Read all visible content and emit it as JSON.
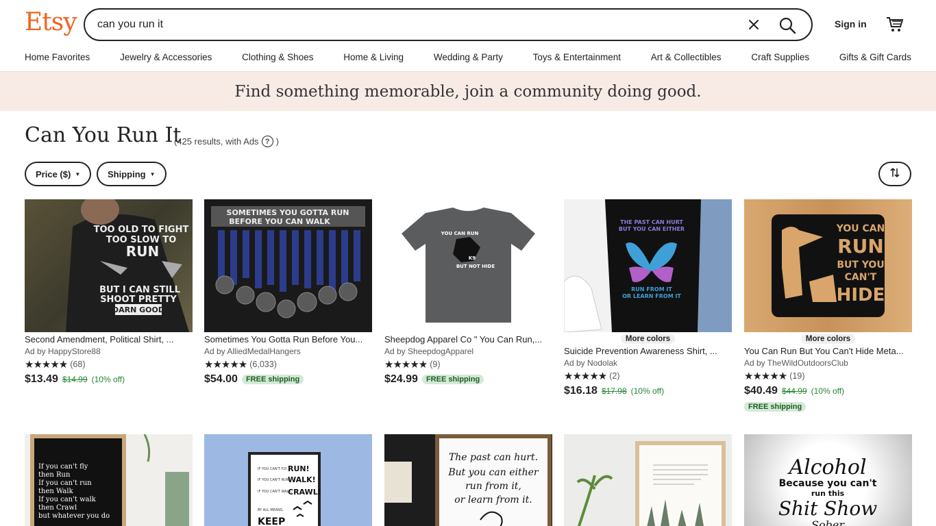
{
  "header": {
    "logo": "Etsy",
    "search_value": "can you run it",
    "sign_in": "Sign in"
  },
  "nav": [
    "Home Favorites",
    "Jewelry & Accessories",
    "Clothing & Shoes",
    "Home & Living",
    "Wedding & Party",
    "Toys & Entertainment",
    "Art & Collectibles",
    "Craft Supplies",
    "Gifts & Gift Cards"
  ],
  "banner": "Find something memorable, join a community doing good.",
  "results": {
    "title": "Can You Run It",
    "meta": "(425 results, with Ads",
    "meta_close": ")"
  },
  "filters": {
    "price": "Price ($)",
    "shipping": "Shipping"
  },
  "listings": [
    {
      "title": "Second Amendment, Political Shirt, ...",
      "shop": "Ad by HappyStore88",
      "stars": "★★★★★",
      "count": "(68)",
      "price": "$13.49",
      "orig": "$14.99",
      "off": "(10% off)",
      "img_text": [
        "TOO OLD TO FIGHT",
        "TOO SLOW TO",
        "RUN",
        "BUT I CAN STILL",
        "SHOOT PRETTY",
        "DARN GOOD"
      ]
    },
    {
      "title": "Sometimes You Gotta Run Before You...",
      "shop": "Ad by AlliedMedalHangers",
      "stars": "★★★★★",
      "count": "(6,033)",
      "price": "$54.00",
      "ship": "FREE shipping",
      "img_text": [
        "SOMETIMES YOU GOTTA RUN",
        "BEFORE YOU CAN WALK"
      ]
    },
    {
      "title": "Sheepdog Apparel Co \" You Can Run,...",
      "shop": "Ad by SheepdogApparel",
      "stars": "★★★★★",
      "count": "(9)",
      "price": "$24.99",
      "ship": "FREE shipping",
      "img_text": [
        "YOU CAN RUN",
        "K9",
        "BUT NOT HIDE"
      ]
    },
    {
      "more": "More colors",
      "title": "Suicide Prevention Awareness Shirt, ...",
      "shop": "Ad by Nodolak",
      "stars": "★★★★★",
      "count": "(2)",
      "price": "$16.18",
      "orig": "$17.98",
      "off": "(10% off)",
      "img_text": [
        "THE PAST CAN HURT",
        "BUT YOU CAN EITHER",
        "RUN FROM IT",
        "OR LEARN FROM IT"
      ]
    },
    {
      "more": "More colors",
      "title": "You Can Run But You Can't Hide Meta...",
      "shop": "Ad by TheWildOutdoorsClub",
      "stars": "★★★★★",
      "count": "(19)",
      "price": "$40.49",
      "orig": "$44.99",
      "off": "(10% off)",
      "ship": "FREE shipping",
      "img_text": [
        "YOU CAN",
        "RUN",
        "BUT YOU",
        "CAN'T",
        "HIDE"
      ]
    }
  ],
  "row2": [
    {
      "img_text": [
        "If you can't fly",
        "then Run",
        "If you can't run",
        "then Walk",
        "If you can't walk",
        "then Crawl",
        "but whatever you do"
      ]
    },
    {
      "img_text": [
        "IF YOU CAN'T FLY,",
        "RUN!",
        "IF YOU CAN'T RUN,",
        "WALK!",
        "IF YOU CAN'T WALK,",
        "CRAWL!",
        "BY ALL MEANS,",
        "KEEP"
      ]
    },
    {
      "img_text": [
        "The past can hurt.",
        "But you can either",
        "run from it,",
        "or learn from it."
      ]
    },
    {
      "img_text": []
    },
    {
      "img_text": [
        "Alcohol",
        "Because you can't",
        "run this",
        "Shit Show",
        "Sober"
      ]
    }
  ],
  "colors": {
    "brand": "#f1641e",
    "banner_bg": "#f8ebe6",
    "green": "#258635"
  }
}
